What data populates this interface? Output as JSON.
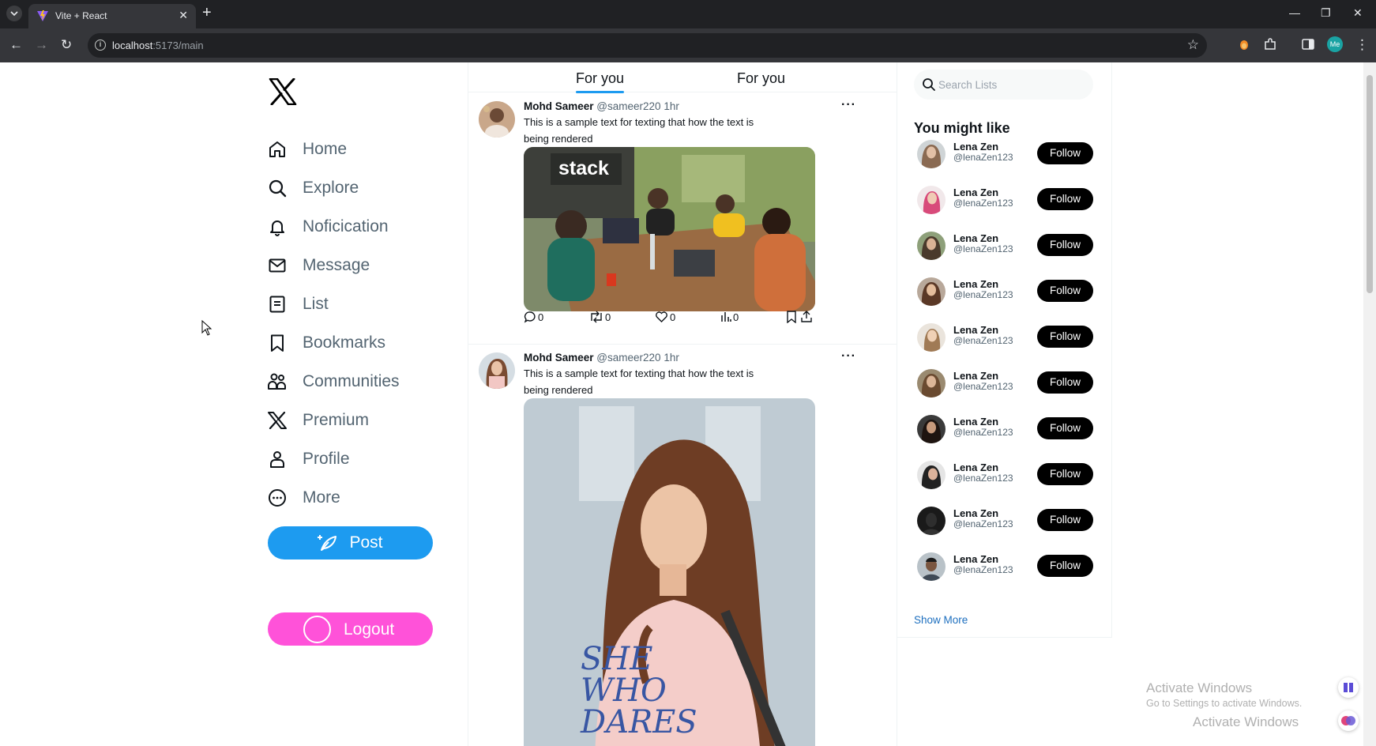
{
  "browser": {
    "tab_title": "Vite + React",
    "url_host": "localhost",
    "url_rest": ":5173/main",
    "profile_initials": "Me"
  },
  "sidebar": {
    "items": [
      {
        "label": "Home",
        "icon": "home-icon"
      },
      {
        "label": "Explore",
        "icon": "search-icon"
      },
      {
        "label": "Noficication",
        "icon": "bell-icon"
      },
      {
        "label": "Message",
        "icon": "mail-icon"
      },
      {
        "label": "List",
        "icon": "list-icon"
      },
      {
        "label": "Bookmarks",
        "icon": "bookmark-icon"
      },
      {
        "label": "Communities",
        "icon": "communities-icon"
      },
      {
        "label": "Premium",
        "icon": "x-logo-icon"
      },
      {
        "label": "Profile",
        "icon": "user-icon"
      },
      {
        "label": "More",
        "icon": "more-circle-icon"
      }
    ],
    "post_label": "Post",
    "logout_label": "Logout"
  },
  "feed": {
    "tabs": [
      "For you",
      "For you"
    ],
    "tweets": [
      {
        "name": "Mohd Sameer",
        "handle": "@sameer220",
        "time": "1hr",
        "text": "This is a sample text for texting that how the text is being rendered",
        "media_label": "stack",
        "stats": {
          "replies": "0",
          "retweets": "0",
          "likes": "0",
          "views": "0"
        }
      },
      {
        "name": "Mohd Sameer",
        "handle": "@sameer220",
        "time": "1hr",
        "text": "This is a sample text for texting that how the text is being rendered",
        "media_label": "SHE WHO DARES"
      }
    ]
  },
  "right": {
    "search_placeholder": "Search Lists",
    "heading": "You might like",
    "suggestions": [
      {
        "name": "Lena Zen",
        "handle": "@lenaZen123",
        "button": "Follow"
      },
      {
        "name": "Lena Zen",
        "handle": "@lenaZen123",
        "button": "Follow"
      },
      {
        "name": "Lena Zen",
        "handle": "@lenaZen123",
        "button": "Follow"
      },
      {
        "name": "Lena Zen",
        "handle": "@lenaZen123",
        "button": "Follow"
      },
      {
        "name": "Lena Zen",
        "handle": "@lenaZen123",
        "button": "Follow"
      },
      {
        "name": "Lena Zen",
        "handle": "@lenaZen123",
        "button": "Follow"
      },
      {
        "name": "Lena Zen",
        "handle": "@lenaZen123",
        "button": "Follow"
      },
      {
        "name": "Lena Zen",
        "handle": "@lenaZen123",
        "button": "Follow"
      },
      {
        "name": "Lena Zen",
        "handle": "@lenaZen123",
        "button": "Follow"
      },
      {
        "name": "Lena Zen",
        "handle": "@lenaZen123",
        "button": "Follow"
      }
    ],
    "show_more": "Show More"
  },
  "watermark": {
    "title": "Activate Windows",
    "subtitle": "Go to Settings to activate Windows."
  },
  "colors": {
    "accent": "#1d9bf0",
    "logout": "#ff52d9",
    "follow": "#000000"
  }
}
